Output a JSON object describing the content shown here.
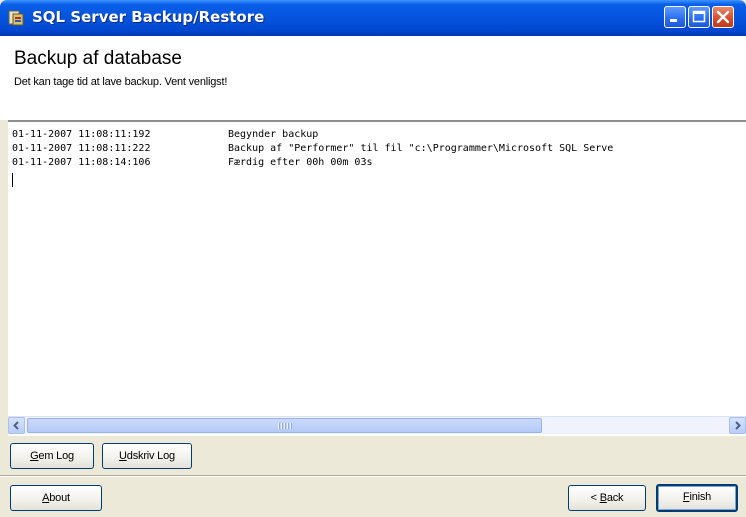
{
  "window": {
    "title": "SQL Server Backup/Restore",
    "icon": "sql-server-app-icon",
    "controls": [
      "minimize-icon",
      "maximize-icon",
      "close-icon"
    ]
  },
  "header": {
    "title": "Backup af database",
    "subtitle": "Det kan tage tid at lave backup. Vent venligst!"
  },
  "log": {
    "lines": [
      {
        "timestamp": "01-11-2007 11:08:11:192",
        "message": "Begynder backup"
      },
      {
        "timestamp": "01-11-2007 11:08:11:222",
        "message": "Backup af \"Performer\" til fil \"c:\\Programmer\\Microsoft SQL Serve"
      },
      {
        "timestamp": "01-11-2007 11:08:14:106",
        "message": "Færdig efter 00h 00m 03s"
      }
    ]
  },
  "log_buttons": {
    "save_pre": "",
    "save_key": "G",
    "save_post": "em Log",
    "print_pre": "",
    "print_key": "U",
    "print_post": "dskriv Log"
  },
  "footer": {
    "about_pre": "",
    "about_key": "A",
    "about_post": "bout",
    "back_pre": "< ",
    "back_key": "B",
    "back_post": "ack",
    "finish_pre": "",
    "finish_key": "F",
    "finish_post": "inish"
  },
  "colors": {
    "titlebar": "#0553DD",
    "window_bg": "#ECE9D8",
    "button_border": "#003C74"
  }
}
